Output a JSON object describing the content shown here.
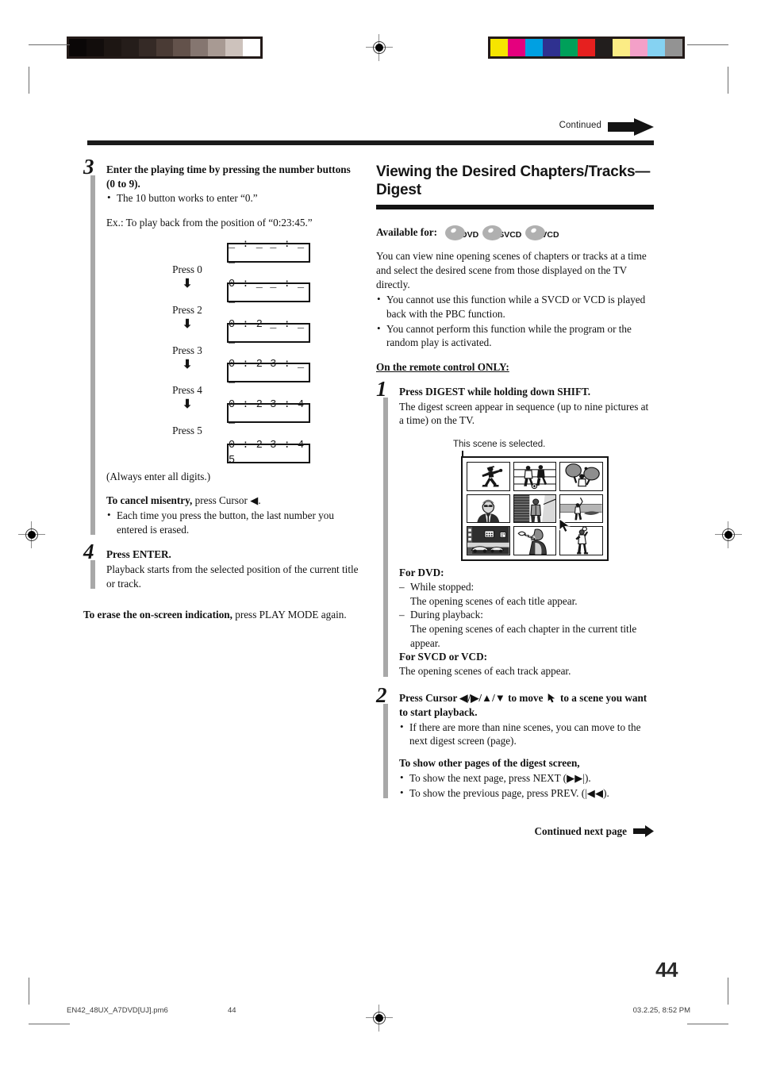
{
  "header": {
    "continued_label": "Continued",
    "continued_arrow_icon": "right-arrow-flag-icon"
  },
  "left_column": {
    "step3": {
      "number": "3",
      "title": "Enter the playing time by pressing the number buttons (0 to 9).",
      "bullets": [
        "The 10 button works to enter “0.”"
      ],
      "example_intro": "Ex.: To play back from the position of “0:23:45.”",
      "sequence": [
        {
          "display": "_ : _ _ : _ _",
          "press_label": ""
        },
        {
          "display": "0 : _ _ : _ _",
          "press_label": "Press 0"
        },
        {
          "display": "0 : 2 _ : _ _",
          "press_label": "Press 2"
        },
        {
          "display": "0 : 2 3 : _ _",
          "press_label": "Press 3"
        },
        {
          "display": "0 : 2 3 : 4 _",
          "press_label": "Press 4"
        },
        {
          "display": "0 : 2 3 : 4 5",
          "press_label": "Press 5"
        }
      ],
      "note_all_digits": "(Always enter all digits.)",
      "cancel_heading": "To cancel misentry,",
      "cancel_rest": " press Cursor ◀.",
      "cancel_bullets": [
        "Each time you press the button, the last number you entered is erased."
      ]
    },
    "step4": {
      "number": "4",
      "title": "Press ENTER.",
      "text": "Playback starts from the selected position of the current title or track."
    },
    "erase_note_bold": "To erase the on-screen indication,",
    "erase_note_rest": " press PLAY MODE again."
  },
  "right_column": {
    "section_title_line1": "Viewing the Desired Chapters/Tracks—",
    "section_title_line2": "Digest",
    "available_label": "Available for:",
    "available_discs": [
      {
        "label": "DVD",
        "icon": "disc-icon"
      },
      {
        "label": "SVCD",
        "icon": "disc-icon"
      },
      {
        "label": "VCD",
        "icon": "disc-icon"
      }
    ],
    "intro": "You can view nine opening scenes of chapters or tracks at a time and select the desired scene from those displayed on the TV directly.",
    "intro_bullets": [
      "You cannot use this function while a SVCD or VCD is played back with the PBC function.",
      "You cannot perform this function while the program or the random play is activated."
    ],
    "remote_only_heading": "On the remote control ONLY:",
    "step1": {
      "number": "1",
      "title": "Press DIGEST while holding down SHIFT.",
      "text": "The digest screen appear in sequence (up to nine pictures at a time) on the TV."
    },
    "figure": {
      "caption": "This scene is selected.",
      "cursor_icon": "pointer-arrow-icon",
      "thumbnails": [
        "baseball-pitcher-scene",
        "soccer-players-scene",
        "table-tennis-scene",
        "news-anchor-scene",
        "street-performer-scene",
        "golf-swing-scene",
        "car-showroom-scene",
        "trumpet-player-scene",
        "basketball-player-scene"
      ]
    },
    "for_dvd_heading": "For DVD:",
    "for_dvd_items": [
      {
        "dash": "While stopped:",
        "sub": "The opening scenes of each title appear."
      },
      {
        "dash": "During playback:",
        "sub": "The opening scenes of each chapter in the current title appear."
      }
    ],
    "for_svcd_heading": "For SVCD or VCD:",
    "for_svcd_text": "The opening scenes of each track appear.",
    "step2": {
      "number": "2",
      "title_part1": "Press Cursor ◀/▶/▲/▼ to move ",
      "title_part2": " to a scene you want to start playback.",
      "bullets": [
        "If there are more than nine scenes, you can move to the next digest screen (page)."
      ],
      "other_pages_heading": "To show other pages of the digest screen,",
      "other_pages_bullets": [
        "To show the next page, press NEXT (▶▶|).",
        "To show the previous page, press PREV. (|◀◀)."
      ]
    }
  },
  "continued_next_page": {
    "label": "Continued next page",
    "arrow_icon": "right-arrow-icon"
  },
  "page_number": "44",
  "footer": {
    "file_name": "EN42_48UX_A7DVD[UJ].pm6",
    "page": "44",
    "date": "03.2.25, 8:52 PM"
  },
  "print_marks": {
    "gray_swatches": [
      "#0a0707",
      "#120d0c",
      "#1d1613",
      "#251d1a",
      "#352a26",
      "#4a3b35",
      "#63524b",
      "#857670",
      "#a89a93",
      "#cdc2bc",
      "#ffffff"
    ],
    "color_swatches": [
      "#f6e500",
      "#e5007e",
      "#00a0e2",
      "#2f3190",
      "#00a05a",
      "#e6201f",
      "#221e1d",
      "#fbec85",
      "#f3a0c8",
      "#85d2f2",
      "#939393"
    ]
  }
}
